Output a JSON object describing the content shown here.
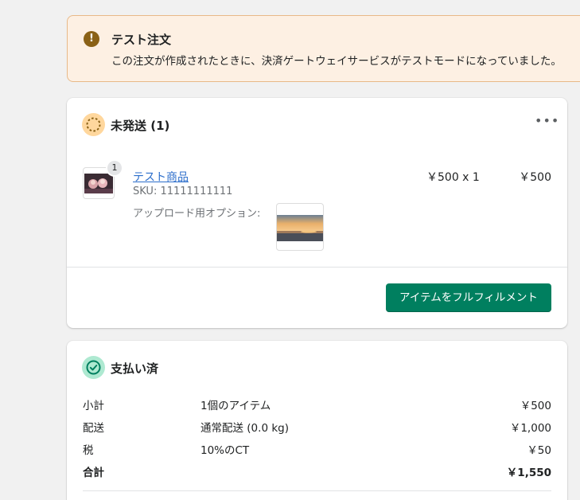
{
  "banner": {
    "title": "テスト注文",
    "message": "この注文が作成されたときに、決済ゲートウェイサービスがテストモードになっていました。",
    "icon": "exclamation-icon",
    "color": "#fdf0e3"
  },
  "unfulfilled": {
    "title": "未発送 (1)",
    "more_label": "•••",
    "item": {
      "quantity_badge": "1",
      "name": "テスト商品",
      "sku": "SKU: 11111111111",
      "option_label": "アップロード用オプション:",
      "unit_price": "￥500 x 1",
      "total": "￥500"
    },
    "fulfill_button_label": "アイテムをフルフィルメント",
    "accent": "#007f5f"
  },
  "paid": {
    "title": "支払い済",
    "rows": [
      {
        "label": "小計",
        "desc": "1個のアイテム",
        "amount": "￥500"
      },
      {
        "label": "配送",
        "desc": "通常配送 (0.0 kg)",
        "amount": "￥1,000"
      },
      {
        "label": "税",
        "desc": "10%のCT",
        "amount": "￥50"
      },
      {
        "label": "合計",
        "desc": "",
        "amount": "￥1,550"
      }
    ]
  }
}
